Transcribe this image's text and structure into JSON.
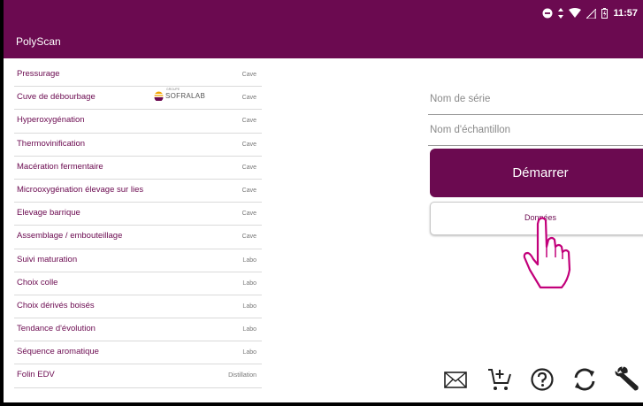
{
  "status": {
    "time": "11:57"
  },
  "app": {
    "title": "PolyScan"
  },
  "logo": {
    "text": "SOFRALAB",
    "sup": "GROUPE"
  },
  "list": [
    {
      "label": "Pressurage",
      "tag": "Cave"
    },
    {
      "label": "Cuve de débourbage",
      "tag": "Cave"
    },
    {
      "label": "Hyperoxygénation",
      "tag": "Cave"
    },
    {
      "label": "Thermovinification",
      "tag": "Cave"
    },
    {
      "label": "Macération fermentaire",
      "tag": "Cave"
    },
    {
      "label": "Microoxygénation élevage sur lies",
      "tag": "Cave"
    },
    {
      "label": "Elevage barrique",
      "tag": "Cave"
    },
    {
      "label": "Assemblage / embouteillage",
      "tag": "Cave"
    },
    {
      "label": "Suivi maturation",
      "tag": "Labo"
    },
    {
      "label": "Choix colle",
      "tag": "Labo"
    },
    {
      "label": "Choix dérivés boisés",
      "tag": "Labo"
    },
    {
      "label": "Tendance d'évolution",
      "tag": "Labo"
    },
    {
      "label": "Séquence aromatique",
      "tag": "Labo"
    },
    {
      "label": "Folin EDV",
      "tag": "Distillation"
    }
  ],
  "form": {
    "serie_placeholder": "Nom de série",
    "echantillon_placeholder": "Nom d'échantillon",
    "start_label": "Démarrer",
    "data_label": "Données"
  },
  "toolbar": {
    "icons": [
      "mail-icon",
      "cart-add-icon",
      "help-icon",
      "sync-icon",
      "wrench-icon"
    ]
  },
  "colors": {
    "primary": "#6b0a50"
  }
}
